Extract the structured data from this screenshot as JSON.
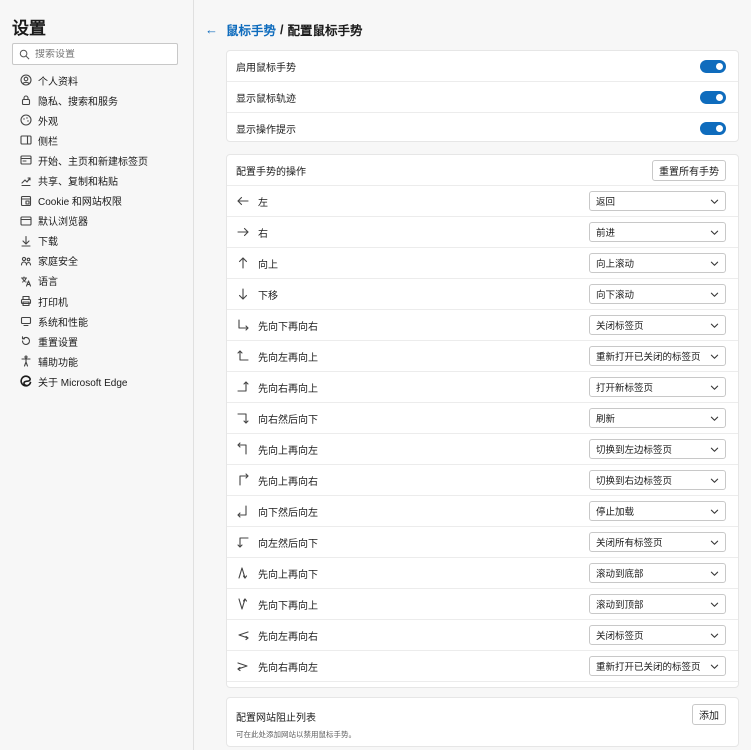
{
  "sidebar": {
    "title": "设置",
    "search_placeholder": "搜索设置",
    "items": [
      {
        "label": "个人资料",
        "icon": "profile-icon"
      },
      {
        "label": "隐私、搜索和服务",
        "icon": "lock-icon"
      },
      {
        "label": "外观",
        "icon": "appearance-icon"
      },
      {
        "label": "侧栏",
        "icon": "sidebar-icon"
      },
      {
        "label": "开始、主页和新建标签页",
        "icon": "home-icon"
      },
      {
        "label": "共享、复制和粘贴",
        "icon": "share-icon"
      },
      {
        "label": "Cookie 和网站权限",
        "icon": "site-permissions-icon"
      },
      {
        "label": "默认浏览器",
        "icon": "browser-icon"
      },
      {
        "label": "下载",
        "icon": "download-icon"
      },
      {
        "label": "家庭安全",
        "icon": "family-icon"
      },
      {
        "label": "语言",
        "icon": "language-icon"
      },
      {
        "label": "打印机",
        "icon": "printer-icon"
      },
      {
        "label": "系统和性能",
        "icon": "system-icon"
      },
      {
        "label": "重置设置",
        "icon": "reset-icon"
      },
      {
        "label": "辅助功能",
        "icon": "accessibility-icon"
      },
      {
        "label": "关于 Microsoft Edge",
        "icon": "edge-icon"
      }
    ]
  },
  "header": {
    "back_icon": "←",
    "parent": "鼠标手势",
    "separator": "/",
    "current": "配置鼠标手势"
  },
  "toggles": [
    {
      "label": "启用鼠标手势",
      "on": true
    },
    {
      "label": "显示鼠标轨迹",
      "on": true
    },
    {
      "label": "显示操作提示",
      "on": true
    }
  ],
  "gestures": {
    "title": "配置手势的操作",
    "reset_label": "重置所有手势",
    "rows": [
      {
        "label": "左",
        "action": "返回",
        "icon": "arrow-left-icon"
      },
      {
        "label": "右",
        "action": "前进",
        "icon": "arrow-right-icon"
      },
      {
        "label": "向上",
        "action": "向上滚动",
        "icon": "arrow-up-icon"
      },
      {
        "label": "下移",
        "action": "向下滚动",
        "icon": "arrow-down-icon"
      },
      {
        "label": "先向下再向右",
        "action": "关闭标签页",
        "icon": "down-right-icon"
      },
      {
        "label": "先向左再向上",
        "action": "重新打开已关闭的标签页",
        "icon": "left-up-icon"
      },
      {
        "label": "先向右再向上",
        "action": "打开新标签页",
        "icon": "right-up-icon"
      },
      {
        "label": "向右然后向下",
        "action": "刷新",
        "icon": "right-down-icon"
      },
      {
        "label": "先向上再向左",
        "action": "切换到左边标签页",
        "icon": "up-left-icon"
      },
      {
        "label": "先向上再向右",
        "action": "切换到右边标签页",
        "icon": "up-right-icon"
      },
      {
        "label": "向下然后向左",
        "action": "停止加载",
        "icon": "down-left-icon"
      },
      {
        "label": "向左然后向下",
        "action": "关闭所有标签页",
        "icon": "left-down-icon"
      },
      {
        "label": "先向上再向下",
        "action": "滚动到底部",
        "icon": "up-down-icon"
      },
      {
        "label": "先向下再向上",
        "action": "滚动到顶部",
        "icon": "down-up-icon"
      },
      {
        "label": "先向左再向右",
        "action": "关闭标签页",
        "icon": "left-right-icon"
      },
      {
        "label": "先向右再向左",
        "action": "重新打开已关闭的标签页",
        "icon": "right-left-icon"
      }
    ]
  },
  "blocklist": {
    "title": "配置网站阻止列表",
    "subtitle": "可在此处添加网站以禁用鼠标手势。",
    "add_label": "添加"
  },
  "colors": {
    "accent": "#0f6cbd",
    "sidebar_bg": "#f7f7f7",
    "card_bg": "#ffffff"
  }
}
